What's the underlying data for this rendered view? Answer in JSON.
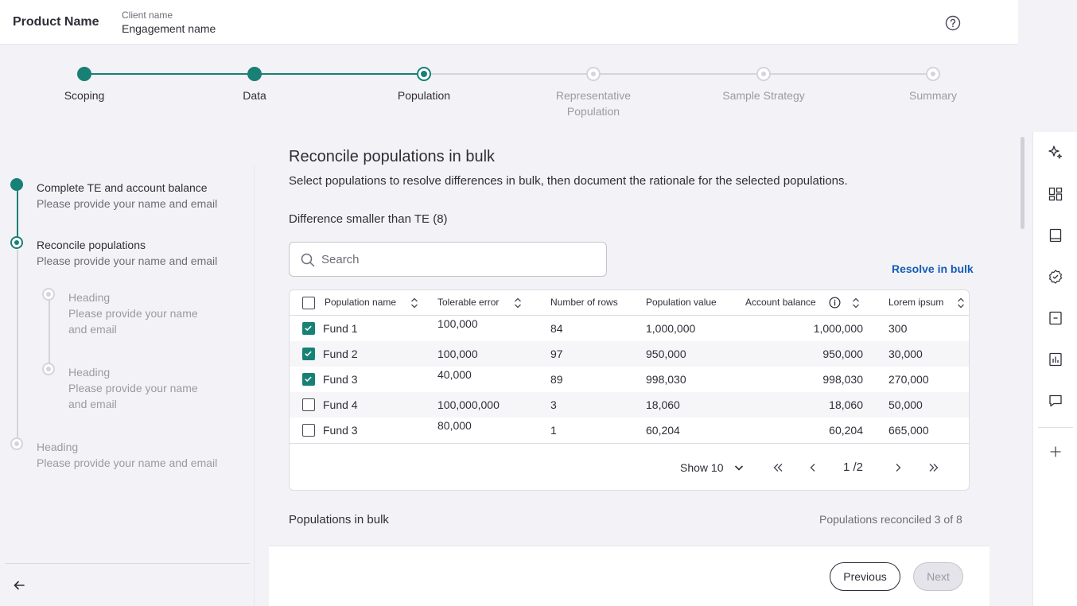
{
  "header": {
    "product_name": "Product Name",
    "client_name": "Client name",
    "engagement_name": "Engagement name"
  },
  "stepper": {
    "steps": [
      {
        "label": "Scoping",
        "status": "done"
      },
      {
        "label": "Data",
        "status": "done"
      },
      {
        "label": "Population",
        "status": "current"
      },
      {
        "label": "Representative Population",
        "status": "todo"
      },
      {
        "label": "Sample Strategy",
        "status": "todo"
      },
      {
        "label": "Summary",
        "status": "todo"
      }
    ]
  },
  "left_panel": {
    "items": [
      {
        "title": "Complete TE and account balance",
        "subtitle": "Please provide your name and email",
        "status": "done"
      },
      {
        "title": "Reconcile populations",
        "subtitle": "Please provide your name and email",
        "status": "current"
      },
      {
        "title": "Heading",
        "subtitle": "Please provide your name and email",
        "status": "todo"
      },
      {
        "title": "Heading",
        "subtitle": "Please provide your name and email",
        "status": "todo"
      },
      {
        "title": "Heading",
        "subtitle": "Please provide your name and email",
        "status": "todo"
      }
    ]
  },
  "main": {
    "title": "Reconcile populations in bulk",
    "description": "Select populations to resolve differences in bulk, then document the rationale for the selected populations.",
    "section_title": "Difference smaller than TE (8)",
    "search_placeholder": "Search",
    "resolve_label": "Resolve in bulk"
  },
  "table": {
    "columns": [
      "Population name",
      "Tolerable error",
      "Number of rows",
      "Population value",
      "Account balance",
      "Lorem ipsum"
    ],
    "rows": [
      {
        "checked": true,
        "name": "Fund 1",
        "te": "100,000",
        "rows": "84",
        "value": "1,000,000",
        "balance": "1,000,000",
        "lorem": "300"
      },
      {
        "checked": true,
        "name": "Fund 2",
        "te": "100,000",
        "rows": "97",
        "value": "950,000",
        "balance": "950,000",
        "lorem": "30,000"
      },
      {
        "checked": true,
        "name": "Fund 3",
        "te": "40,000",
        "rows": "89",
        "value": "998,030",
        "balance": "998,030",
        "lorem": "270,000"
      },
      {
        "checked": false,
        "name": "Fund 4",
        "te": "100,000,000",
        "rows": "3",
        "value": "18,060",
        "balance": "18,060",
        "lorem": "50,000"
      },
      {
        "checked": false,
        "name": "Fund 3",
        "te": "80,000",
        "rows": "1",
        "value": "60,204",
        "balance": "60,204",
        "lorem": "665,000"
      }
    ],
    "show_label": "Show 10",
    "page_indicator": "1 /2"
  },
  "bulk": {
    "title": "Populations in bulk",
    "reconciled": "Populations reconciled 3 of 8"
  },
  "footer": {
    "previous_label": "Previous",
    "next_label": "Next"
  },
  "colors": {
    "accent": "#188075",
    "link": "#155cb4"
  }
}
